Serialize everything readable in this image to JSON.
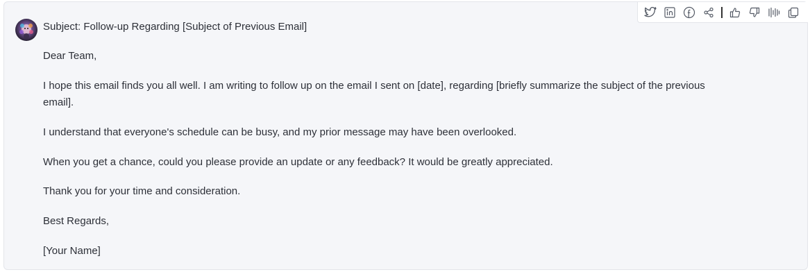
{
  "toolbar": {
    "icons": [
      "twitter-icon",
      "linkedin-icon",
      "facebook-icon",
      "share-icon",
      "thumbs-up-icon",
      "thumbs-down-icon",
      "audio-icon",
      "copy-icon"
    ]
  },
  "message": {
    "subject": "Subject: Follow-up Regarding [Subject of Previous Email]",
    "greeting": "Dear Team,",
    "paragraph1": "I hope this email finds you all well. I am writing to follow up on the email I sent on [date], regarding [briefly summarize the subject of the previous email].",
    "paragraph2": "I understand that everyone's schedule can be busy, and my prior message may have been overlooked.",
    "paragraph3": "When you get a chance, could you please provide an update or any feedback? It would be greatly appreciated.",
    "paragraph4": "Thank you for your time and consideration.",
    "closing": "Best Regards,",
    "signature": "[Your Name]"
  },
  "colors": {
    "card_background": "#f5f6f9",
    "text": "#2d3038",
    "icon": "#555b66"
  }
}
